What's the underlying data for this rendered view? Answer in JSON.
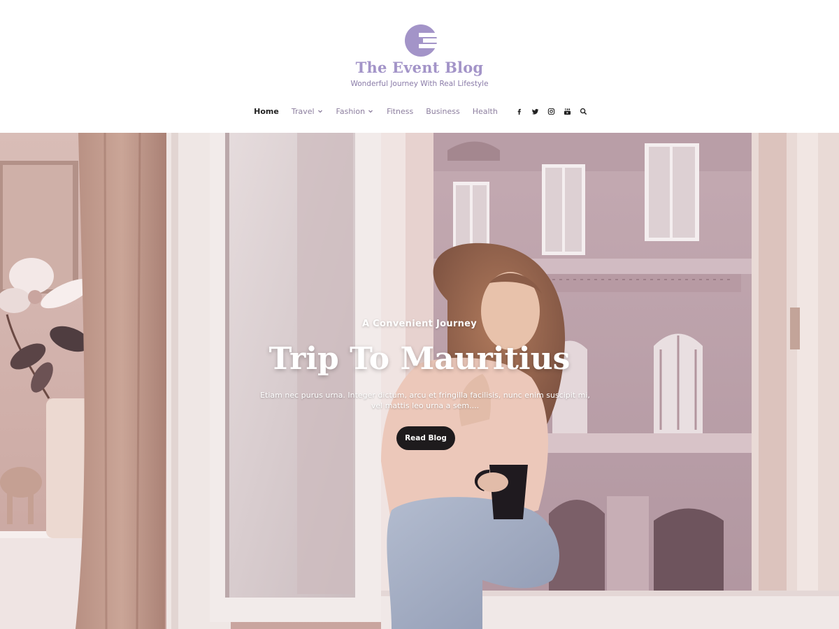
{
  "site": {
    "logo_icon": "letter-e-logo-icon",
    "title": "The Event Blog",
    "tagline": "Wonderful Journey With Real Lifestyle"
  },
  "nav": {
    "items": [
      {
        "label": "Home",
        "active": true,
        "has_dropdown": false
      },
      {
        "label": "Travel",
        "active": false,
        "has_dropdown": true
      },
      {
        "label": "Fashion",
        "active": false,
        "has_dropdown": true
      },
      {
        "label": "Fitness",
        "active": false,
        "has_dropdown": false
      },
      {
        "label": "Business",
        "active": false,
        "has_dropdown": false
      },
      {
        "label": "Health",
        "active": false,
        "has_dropdown": false
      }
    ],
    "social_icons": [
      "facebook-icon",
      "twitter-icon",
      "instagram-icon",
      "youtube-icon",
      "search-icon"
    ]
  },
  "hero": {
    "kicker": "A Convenient Journey",
    "title": "Trip To Mauritius",
    "excerpt": "Etiam nec purus urna. Integer dictum, arcu et fringilla facilisis, nunc enim suscipit mi, vel mattis leo urna a sem....",
    "button_label": "Read Blog"
  },
  "colors": {
    "accent": "#a394c8",
    "nav_text": "#8c7e9e",
    "nav_active": "#222222",
    "button_bg": "#1e1b1d",
    "hero_tint": "#e7d3d0"
  }
}
